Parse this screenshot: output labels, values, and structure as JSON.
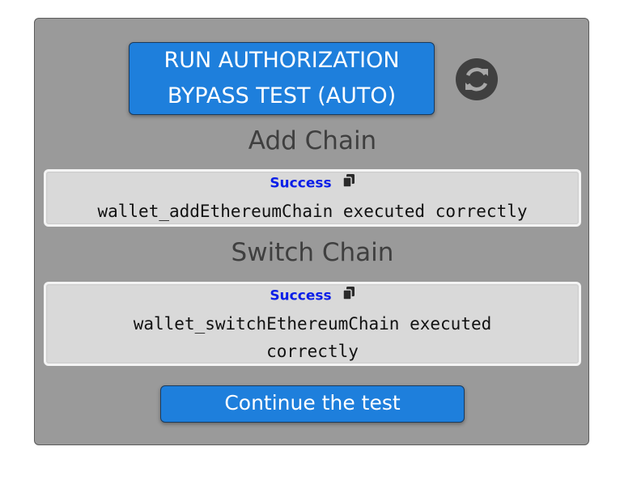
{
  "run_button": {
    "line1": "RUN AUTHORIZATION",
    "line2": "BYPASS TEST (AUTO)"
  },
  "refresh_icon": "refresh-icon",
  "sections": [
    {
      "title": "Add Chain",
      "status": "Success",
      "message": "wallet_addEthereumChain executed correctly"
    },
    {
      "title": "Switch Chain",
      "status": "Success",
      "message": "wallet_switchEthereumChain executed correctly"
    }
  ],
  "continue_button": {
    "label": "Continue the test"
  },
  "colors": {
    "panel": "#9a9a9a",
    "button": "#1e7fdc",
    "success_text": "#0a1ee8",
    "result_box": "#d9d9d9"
  }
}
